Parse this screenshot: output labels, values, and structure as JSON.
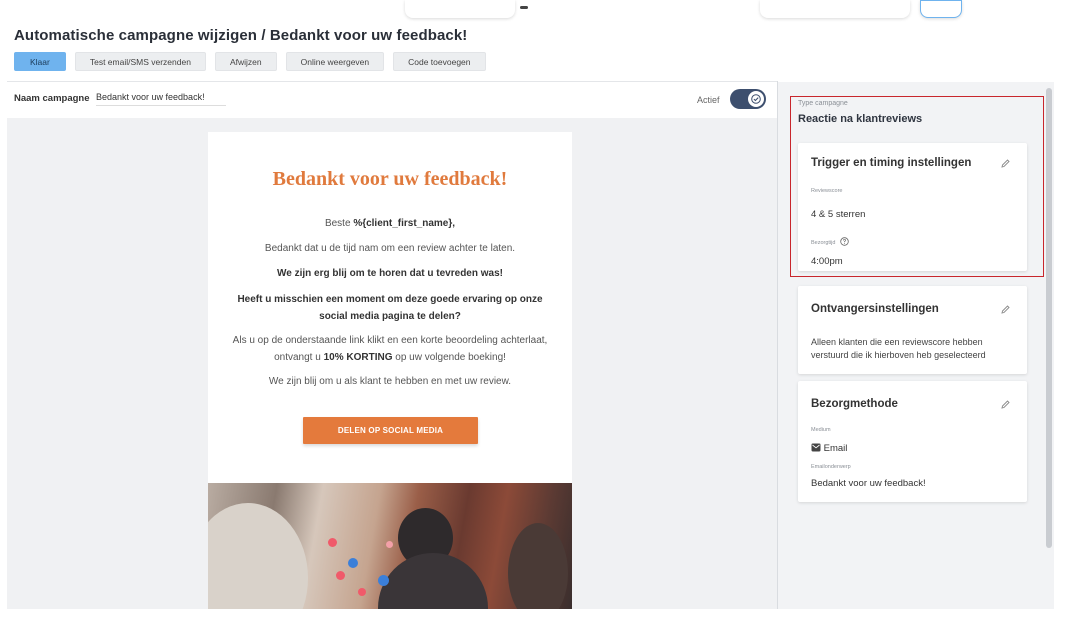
{
  "page": {
    "title": "Automatische campagne wijzigen / Bedankt voor uw feedback!"
  },
  "toolbar": {
    "buttons": [
      {
        "label": "Klaar"
      },
      {
        "label": "Test email/SMS verzenden"
      },
      {
        "label": "Afwijzen"
      },
      {
        "label": "Online weergeven"
      },
      {
        "label": "Code toevoegen"
      }
    ]
  },
  "campaign": {
    "name_label": "Naam campagne",
    "name_value": "Bedankt voor uw feedback!",
    "active_label": "Actief",
    "active": true
  },
  "email": {
    "title": "Bedankt voor uw feedback!",
    "greeting_prefix": "Beste ",
    "greeting_var": "%{client_first_name},",
    "line1": "Bedankt dat u de tijd nam om een review achter te laten.",
    "line2": "We zijn erg blij om te horen dat u tevreden was!",
    "line3": "Heeft u misschien een moment om deze goede ervaring op onze social media pagina te delen?",
    "line4_part1": "Als u op de onderstaande link klikt en een korte beoordeling achterlaat, ontvangt u ",
    "line4_bold": "10% KORTING",
    "line4_part2": " op uw volgende boeking!",
    "line5": "We zijn blij om u als klant te hebben en met uw review.",
    "cta": "DELEN OP SOCIAL MEDIA"
  },
  "panel": {
    "type_label": "Type campagne",
    "type_value": "Reactie na klantreviews",
    "trigger": {
      "title": "Trigger en timing instellingen",
      "score_label": "Reviewscore",
      "score_value": "4 & 5 sterren",
      "time_label": "Bezorgtijd",
      "time_value": "4:00pm"
    },
    "recipients": {
      "title": "Ontvangersinstellingen",
      "text": "Alleen klanten die een reviewscore hebben verstuurd die ik hierboven heb geselecteerd"
    },
    "delivery": {
      "title": "Bezorgmethode",
      "medium_label": "Medium",
      "medium_value": "Email",
      "subject_label": "Emailonderwerp",
      "subject_value": "Bedankt voor uw feedback!"
    }
  },
  "colors": {
    "primary_button": "#6fb3ee",
    "accent_orange": "#e47a3c",
    "toggle": "#3d4f6e",
    "highlight": "#c8262c"
  }
}
